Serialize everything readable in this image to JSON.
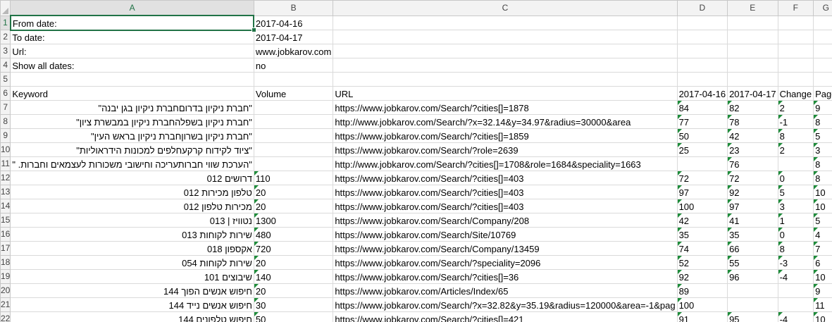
{
  "columns": [
    "A",
    "B",
    "C",
    "D",
    "E",
    "F",
    "G"
  ],
  "params": [
    {
      "row": "1",
      "label": "From date:",
      "value": "2017-04-16"
    },
    {
      "row": "2",
      "label": "To date:",
      "value": "2017-04-17"
    },
    {
      "row": "3",
      "label": "Url:",
      "value": "www.jobkarov.com"
    },
    {
      "row": "4",
      "label": "Show all dates:",
      "value": "no"
    }
  ],
  "empty_row": "5",
  "header_row": {
    "row": "6",
    "keyword": "Keyword",
    "volume": "Volume",
    "url": "URL",
    "d1": "2017-04-16",
    "d2": "2017-04-17",
    "change": "Change",
    "page": "Page"
  },
  "rows": [
    {
      "row": "7",
      "keyword": "\"חברת ניקיון בדרוםחברת ניקיון בגן יבנה\"",
      "volume": "",
      "url": "https://www.jobkarov.com/Search/?cities[]=1878",
      "d1": "84",
      "d2": "82",
      "change": "2",
      "page": "9"
    },
    {
      "row": "8",
      "keyword": "\"חברת ניקיון בשפלהחברת ניקיון במבשרת ציון\"",
      "volume": "",
      "url": "http://www.jobkarov.com/Search/?x=32.14&y=34.97&radius=30000&area",
      "d1": "77",
      "d2": "78",
      "change": "-1",
      "page": "8"
    },
    {
      "row": "9",
      "keyword": "\"חברת ניקיון בשרוןחברת ניקיון בראש העין\"",
      "volume": "",
      "url": "https://www.jobkarov.com/Search/?cities[]=1859",
      "d1": "50",
      "d2": "42",
      "change": "8",
      "page": "5"
    },
    {
      "row": "10",
      "keyword": "\"ציוד לקידוח קרקעחלפים למכונות הידראוליות\"",
      "volume": "",
      "url": "https://www.jobkarov.com/Search/?role=2639",
      "d1": "25",
      "d2": "23",
      "change": "2",
      "page": "3"
    },
    {
      "row": "11",
      "keyword": "\"הערכת שווי חברותעריכה וחישובי משכורות לעצמאים וחברות. \"",
      "volume": "",
      "url": "http://www.jobkarov.com/Search/?cities[]=1708&role=1684&speciality=1663",
      "d1": "",
      "d2": "76",
      "change": "",
      "page": "8"
    },
    {
      "row": "12",
      "keyword": "דרושים 012",
      "volume": "110",
      "url": "https://www.jobkarov.com/Search/?cities[]=403",
      "d1": "72",
      "d2": "72",
      "change": "0",
      "page": "8"
    },
    {
      "row": "13",
      "keyword": "טלפון מכירות 012",
      "volume": "20",
      "url": "https://www.jobkarov.com/Search/?cities[]=403",
      "d1": "97",
      "d2": "92",
      "change": "5",
      "page": "10"
    },
    {
      "row": "14",
      "keyword": "מכירות טלפון 012",
      "volume": "20",
      "url": "https://www.jobkarov.com/Search/?cities[]=403",
      "d1": "100",
      "d2": "97",
      "change": "3",
      "page": "10"
    },
    {
      "row": "15",
      "keyword": "נטוויז | 013",
      "volume": "1300",
      "url": "https://www.jobkarov.com/Search/Company/208",
      "d1": "42",
      "d2": "41",
      "change": "1",
      "page": "5"
    },
    {
      "row": "16",
      "keyword": "שירות לקוחות 013",
      "volume": "480",
      "url": "https://www.jobkarov.com/Search/Site/10769",
      "d1": "35",
      "d2": "35",
      "change": "0",
      "page": "4"
    },
    {
      "row": "17",
      "keyword": "אקספון 018",
      "volume": "720",
      "url": "https://www.jobkarov.com/Search/Company/13459",
      "d1": "74",
      "d2": "66",
      "change": "8",
      "page": "7"
    },
    {
      "row": "18",
      "keyword": "שירות לקוחות 054",
      "volume": "20",
      "url": "https://www.jobkarov.com/Search/?speciality=2096",
      "d1": "52",
      "d2": "55",
      "change": "-3",
      "page": "6"
    },
    {
      "row": "19",
      "keyword": "שיבוצים 101",
      "volume": "140",
      "url": "https://www.jobkarov.com/Search/?cities[]=36",
      "d1": "92",
      "d2": "96",
      "change": "-4",
      "page": "10"
    },
    {
      "row": "20",
      "keyword": "חיפוש אנשים הפוך 144",
      "volume": "20",
      "url": "https://www.jobkarov.com/Articles/Index/65",
      "d1": "89",
      "d2": "",
      "change": "",
      "page": "9"
    },
    {
      "row": "21",
      "keyword": "חיפוש אנשים נייד 144",
      "volume": "30",
      "url": "https://www.jobkarov.com/Search/?x=32.82&y=35.19&radius=120000&area=-1&pag",
      "d1": "100",
      "d2": "",
      "change": "",
      "page": "11"
    },
    {
      "row": "22",
      "keyword": "חיפוש טלפונים 144",
      "volume": "50",
      "url": "https://www.jobkarov.com/Search/?cities[]=421",
      "d1": "91",
      "d2": "95",
      "change": "-4",
      "page": "10"
    }
  ]
}
